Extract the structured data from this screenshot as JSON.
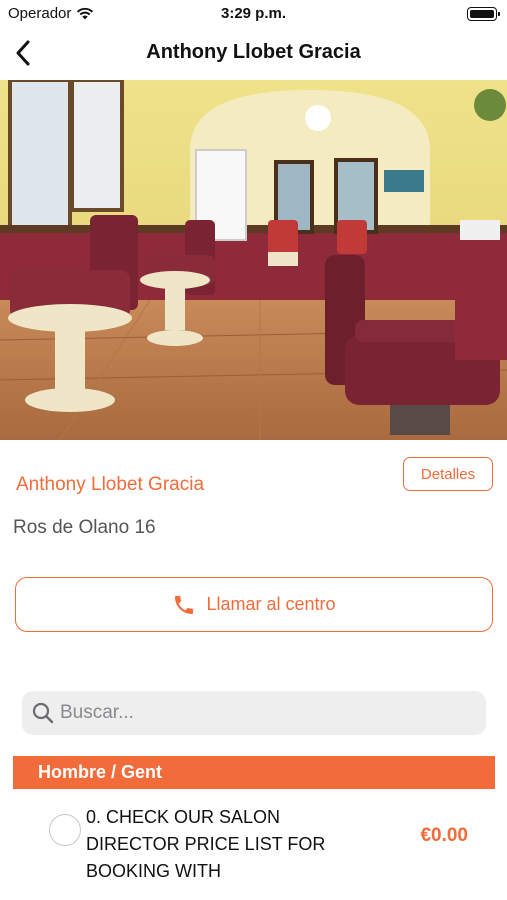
{
  "status_bar": {
    "carrier": "Operador",
    "time": "3:29 p.m."
  },
  "nav": {
    "title": "Anthony Llobet Gracia"
  },
  "salon": {
    "name": "Anthony Llobet Gracia",
    "address": "Ros de Olano 16",
    "details_label": "Detalles",
    "call_label": "Llamar al centro"
  },
  "search": {
    "placeholder": "Buscar..."
  },
  "category": {
    "title": "Hombre / Gent"
  },
  "services": [
    {
      "name": "0. CHECK OUR SALON DIRECTOR PRICE LIST FOR BOOKING WITH",
      "price": "€0.00"
    }
  ],
  "colors": {
    "accent": "#f26b3a",
    "search_bg": "#eeeeef"
  },
  "icons": {
    "back": "chevron-left-icon",
    "call": "phone-icon",
    "search": "search-icon",
    "wifi": "wifi-icon",
    "battery": "battery-icon"
  }
}
